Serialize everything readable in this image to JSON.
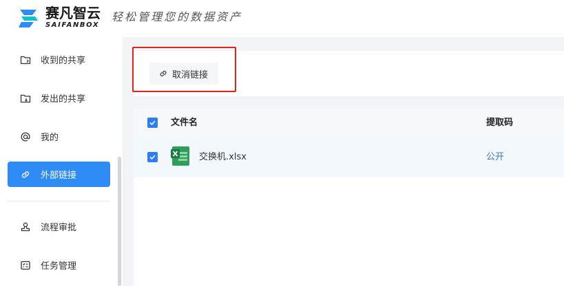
{
  "brand": {
    "name_cn": "赛凡智云",
    "name_en": "SAIFANBOX",
    "slogan": "轻松管理您的数据资产",
    "accent_color": "#2f8bf5",
    "logo_colors": [
      "#2f8bf5",
      "#12c1c7"
    ]
  },
  "sidebar": {
    "items": [
      {
        "label": "收到的共享",
        "icon": "folder-in-icon",
        "active": false
      },
      {
        "label": "发出的共享",
        "icon": "folder-out-icon",
        "active": false
      },
      {
        "label": "我的",
        "icon": "at-icon",
        "active": false
      },
      {
        "label": "外部链接",
        "icon": "link-icon",
        "active": true
      },
      {
        "label": "流程审批",
        "icon": "stamp-icon",
        "active": false
      },
      {
        "label": "任务管理",
        "icon": "task-list-icon",
        "active": false
      }
    ]
  },
  "toolbar": {
    "cancel_link_label": "取消链接",
    "cancel_link_icon": "link-icon"
  },
  "table": {
    "columns": [
      "文件名",
      "提取码"
    ],
    "header_checked": true,
    "rows": [
      {
        "checked": true,
        "file_name": "交换机.xlsx",
        "file_icon": "excel-file-icon",
        "code": "公开"
      }
    ]
  }
}
